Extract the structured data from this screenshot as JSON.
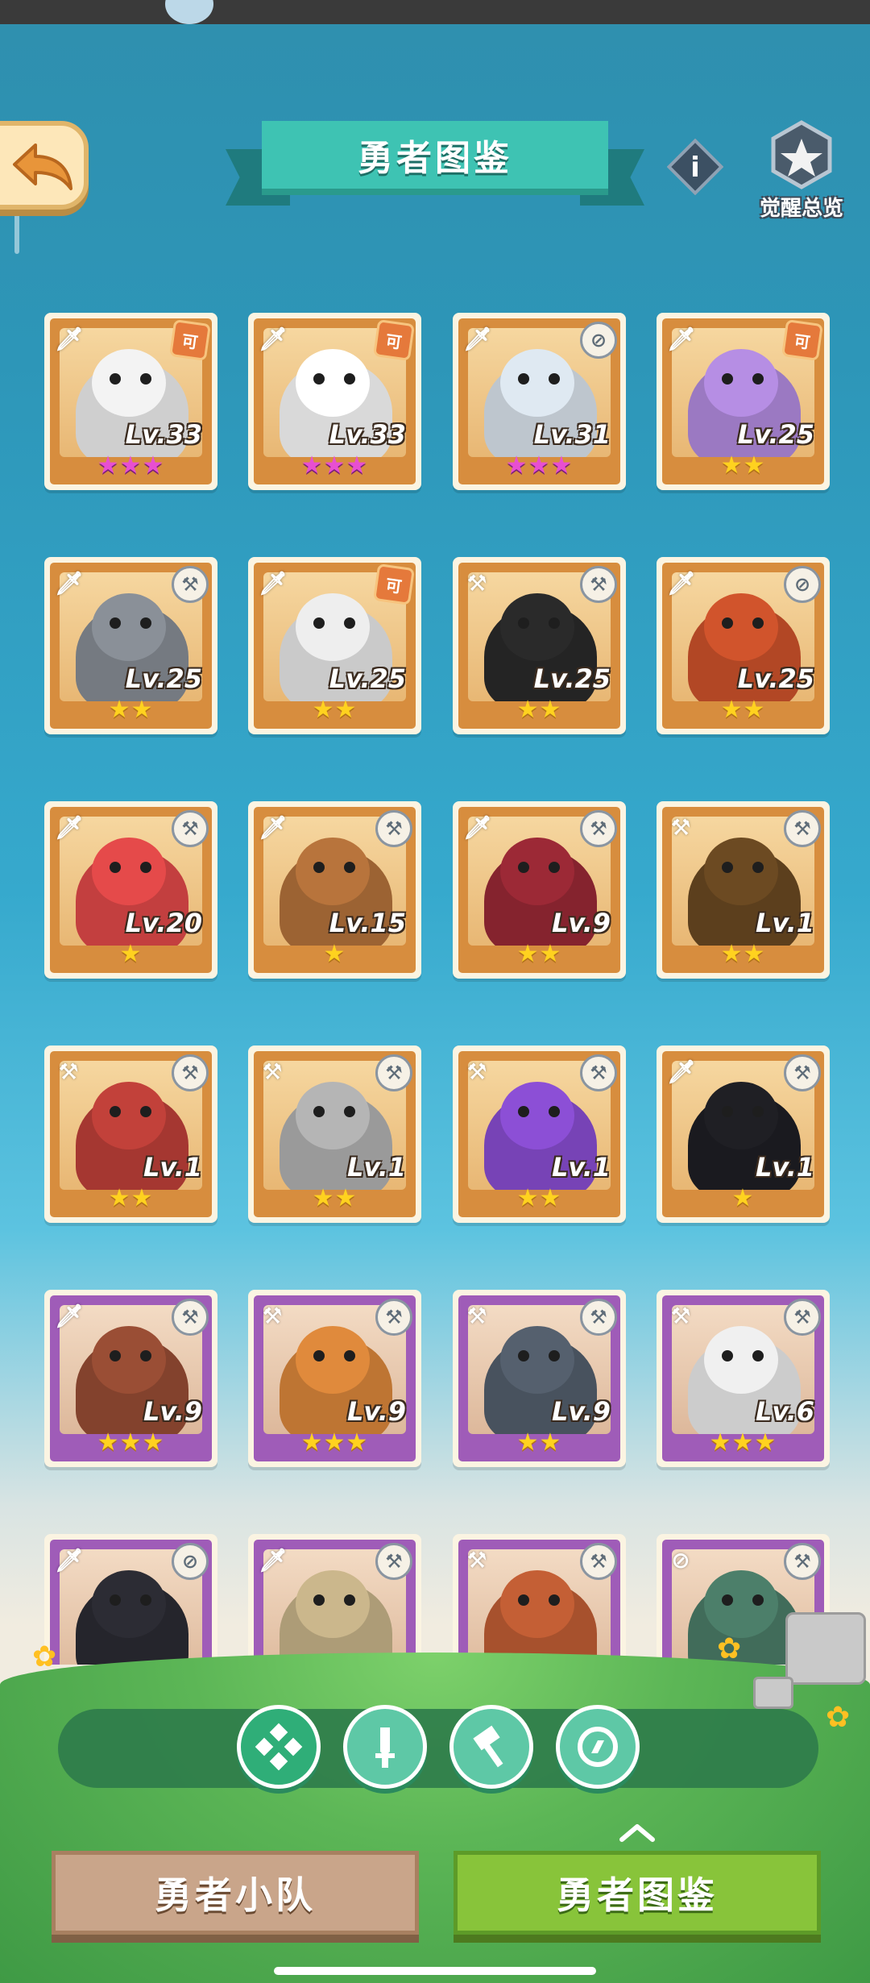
{
  "header": {
    "title": "勇者图鉴",
    "awaken_label": "觉醒总览",
    "info_label": "i"
  },
  "heroes": [
    {
      "level": "Lv.33",
      "stars": "★★★",
      "star_color": "pink",
      "frame": "orange",
      "role": "sword",
      "badge": "tag",
      "color": "#f3f3f3"
    },
    {
      "level": "Lv.33",
      "stars": "★★★",
      "star_color": "pink",
      "frame": "orange",
      "role": "sword",
      "badge": "tag",
      "color": "#ffffff"
    },
    {
      "level": "Lv.31",
      "stars": "★★★",
      "star_color": "pink",
      "frame": "orange",
      "role": "sword",
      "badge": "compass",
      "color": "#dfe9f2"
    },
    {
      "level": "Lv.25",
      "stars": "★★",
      "star_color": "gold",
      "frame": "orange",
      "role": "sword",
      "badge": "tag",
      "color": "#b68ee4"
    },
    {
      "level": "Lv.25",
      "stars": "★★",
      "star_color": "gold",
      "frame": "orange",
      "role": "sword",
      "badge": "hammer",
      "color": "#8a9098"
    },
    {
      "level": "Lv.25",
      "stars": "★★",
      "star_color": "gold",
      "frame": "orange",
      "role": "sword",
      "badge": "tag",
      "color": "#eeeeee"
    },
    {
      "level": "Lv.25",
      "stars": "★★",
      "star_color": "gold",
      "frame": "orange",
      "role": "hammer",
      "badge": "hammer",
      "color": "#2a2a2a"
    },
    {
      "level": "Lv.25",
      "stars": "★★",
      "star_color": "gold",
      "frame": "orange",
      "role": "sword",
      "badge": "compass",
      "color": "#d1542c"
    },
    {
      "level": "Lv.20",
      "stars": "★",
      "star_color": "gold",
      "frame": "orange",
      "role": "sword",
      "badge": "hammer",
      "color": "#e54a4a"
    },
    {
      "level": "Lv.15",
      "stars": "★",
      "star_color": "gold",
      "frame": "orange",
      "role": "sword",
      "badge": "hammer",
      "color": "#b8743c"
    },
    {
      "level": "Lv.9",
      "stars": "★★",
      "star_color": "gold",
      "frame": "orange",
      "role": "sword",
      "badge": "hammer",
      "color": "#9c2936"
    },
    {
      "level": "Lv.1",
      "stars": "★★",
      "star_color": "gold",
      "frame": "orange",
      "role": "hammer",
      "badge": "hammer",
      "color": "#6c4a22"
    },
    {
      "level": "Lv.1",
      "stars": "★★",
      "star_color": "gold",
      "frame": "orange",
      "role": "hammer",
      "badge": "hammer",
      "color": "#c2413a"
    },
    {
      "level": "Lv.1",
      "stars": "★★",
      "star_color": "gold",
      "frame": "orange",
      "role": "hammer",
      "badge": "hammer",
      "color": "#b5b5b5"
    },
    {
      "level": "Lv.1",
      "stars": "★★",
      "star_color": "gold",
      "frame": "orange",
      "role": "hammer",
      "badge": "hammer",
      "color": "#8c4fd6"
    },
    {
      "level": "Lv.1",
      "stars": "★",
      "star_color": "gold",
      "frame": "orange",
      "role": "sword",
      "badge": "hammer",
      "color": "#1f1f24"
    },
    {
      "level": "Lv.9",
      "stars": "★★★",
      "star_color": "gold",
      "frame": "purple",
      "role": "sword",
      "badge": "hammer",
      "color": "#9a4e35"
    },
    {
      "level": "Lv.9",
      "stars": "★★★",
      "star_color": "gold",
      "frame": "purple",
      "role": "hammer",
      "badge": "hammer",
      "color": "#e08a3c"
    },
    {
      "level": "Lv.9",
      "stars": "★★",
      "star_color": "gold",
      "frame": "purple",
      "role": "hammer",
      "badge": "hammer",
      "color": "#55606e"
    },
    {
      "level": "Lv.6",
      "stars": "★★★",
      "star_color": "gold",
      "frame": "purple",
      "role": "hammer",
      "badge": "hammer",
      "color": "#f0f0f0"
    },
    {
      "level": "",
      "stars": "",
      "star_color": "gold",
      "frame": "purple",
      "role": "sword",
      "badge": "compass",
      "color": "#2c2c34"
    },
    {
      "level": "",
      "stars": "",
      "star_color": "gold",
      "frame": "purple",
      "role": "sword",
      "badge": "hammer",
      "color": "#cbb78c"
    },
    {
      "level": "",
      "stars": "",
      "star_color": "gold",
      "frame": "purple",
      "role": "hammer",
      "badge": "hammer",
      "color": "#c45f35"
    },
    {
      "level": "",
      "stars": "",
      "star_color": "gold",
      "frame": "purple",
      "role": "compass",
      "badge": "hammer",
      "color": "#4c7f6a"
    }
  ],
  "filters": [
    {
      "icon": "all-icon",
      "active": true
    },
    {
      "icon": "sword-icon",
      "active": false
    },
    {
      "icon": "hammer-icon",
      "active": false
    },
    {
      "icon": "compass-icon",
      "active": false
    }
  ],
  "bottom": {
    "team_label": "勇者小队",
    "codex_label": "勇者图鉴"
  }
}
